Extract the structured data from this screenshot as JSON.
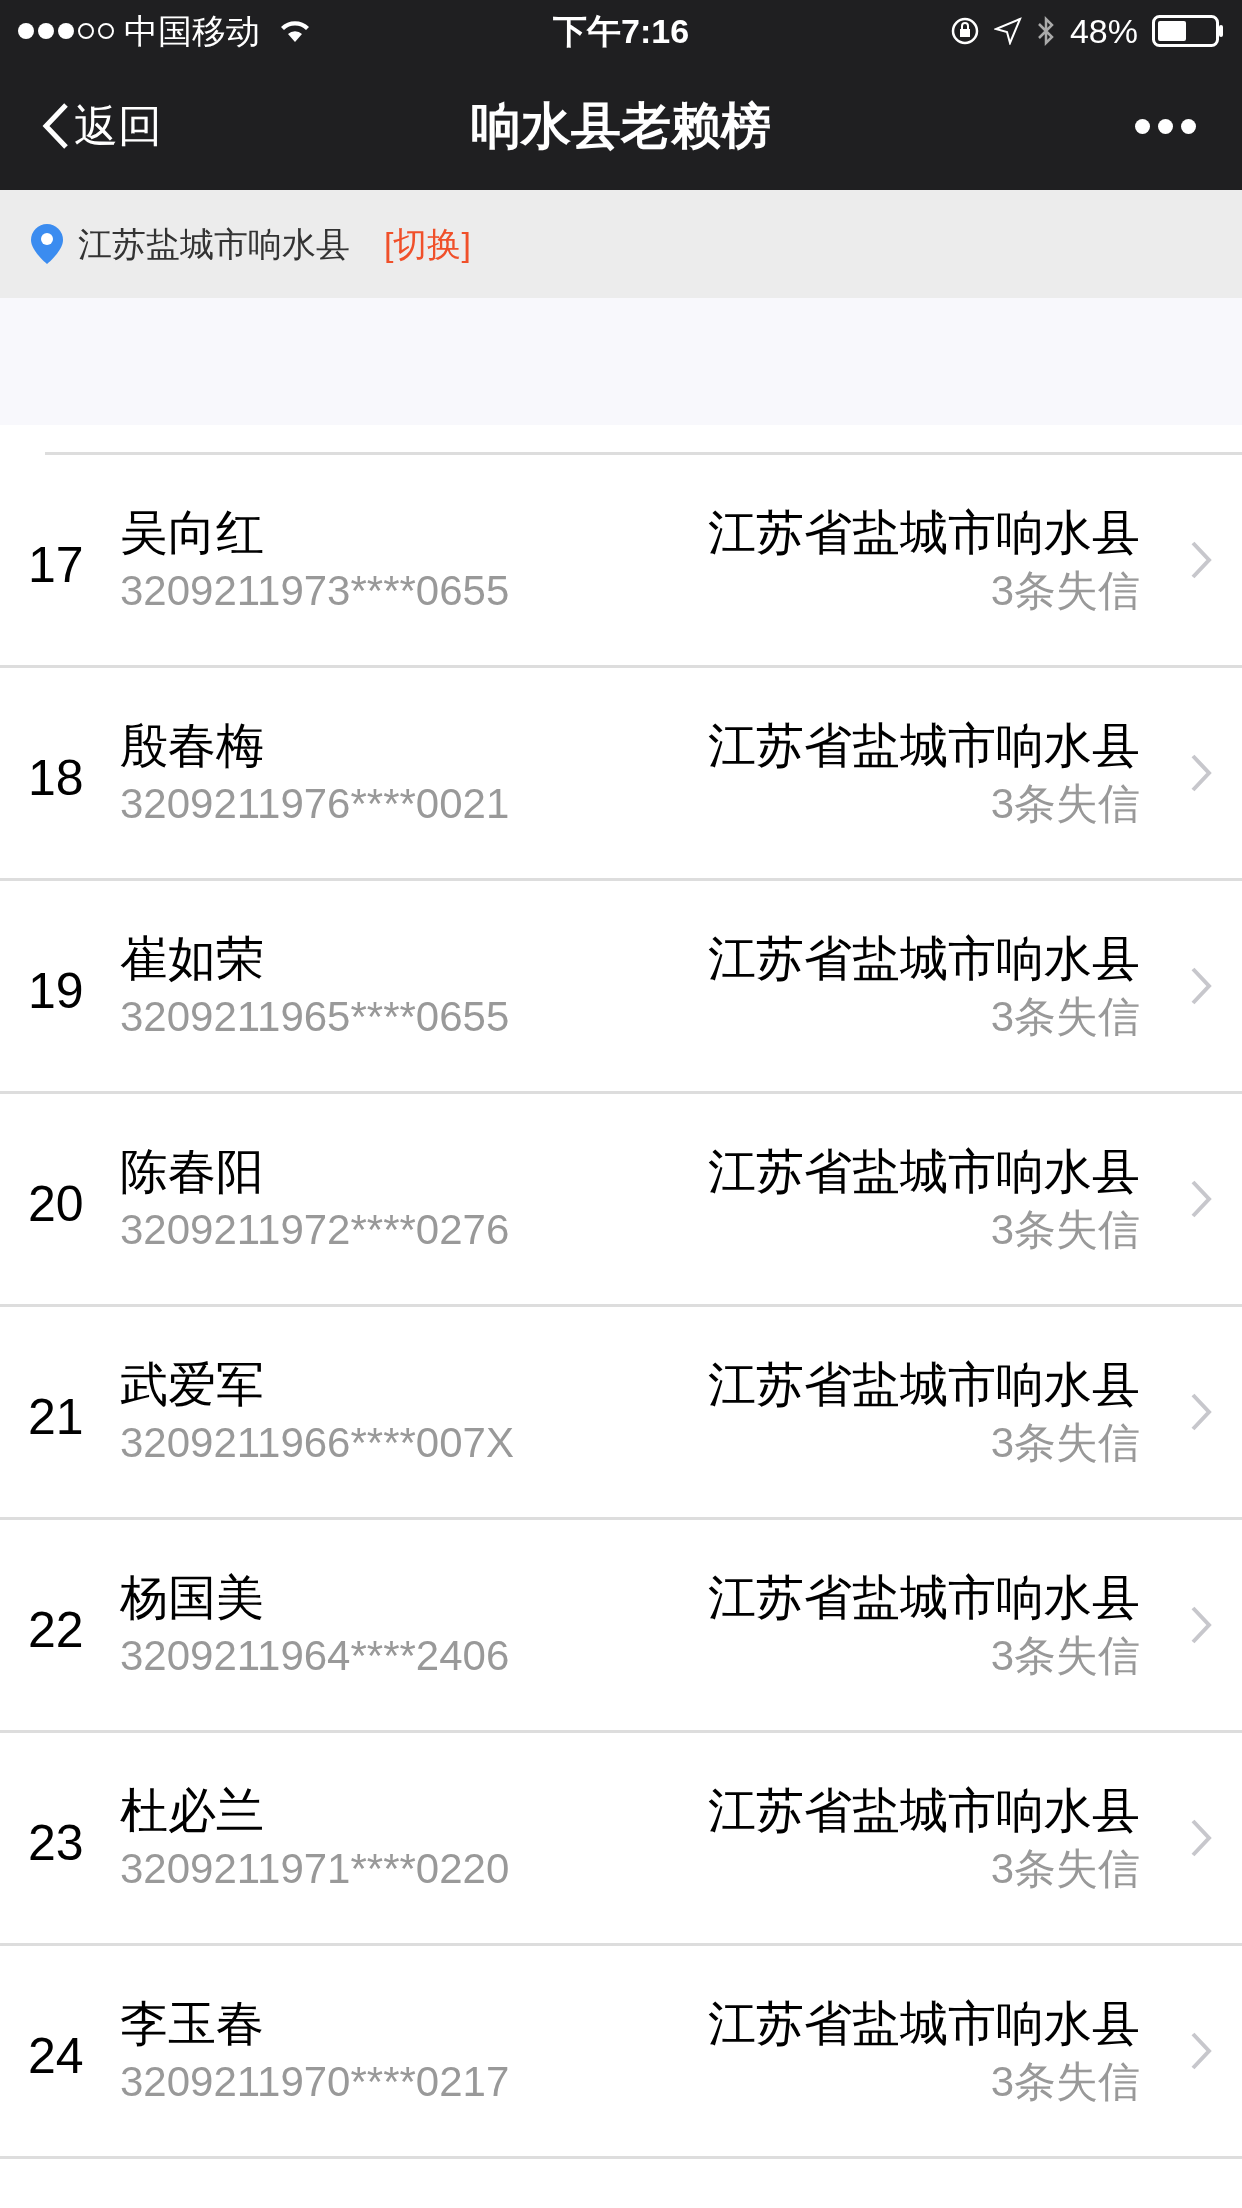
{
  "status_bar": {
    "carrier": "中国移动",
    "time": "下午7:16",
    "battery": "48%"
  },
  "nav_bar": {
    "back": "返回",
    "title": "响水县老赖榜"
  },
  "location": {
    "text": "江苏盐城市响水县",
    "switch": "[切换]"
  },
  "rows": [
    {
      "rank": "17",
      "name": "吴向红",
      "id": "3209211973****0655",
      "address": "江苏省盐城市响水县",
      "records": "3条失信"
    },
    {
      "rank": "18",
      "name": "殷春梅",
      "id": "3209211976****0021",
      "address": "江苏省盐城市响水县",
      "records": "3条失信"
    },
    {
      "rank": "19",
      "name": "崔如荣",
      "id": "3209211965****0655",
      "address": "江苏省盐城市响水县",
      "records": "3条失信"
    },
    {
      "rank": "20",
      "name": "陈春阳",
      "id": "3209211972****0276",
      "address": "江苏省盐城市响水县",
      "records": "3条失信"
    },
    {
      "rank": "21",
      "name": "武爱军",
      "id": "3209211966****007X",
      "address": "江苏省盐城市响水县",
      "records": "3条失信"
    },
    {
      "rank": "22",
      "name": "杨国美",
      "id": "3209211964****2406",
      "address": "江苏省盐城市响水县",
      "records": "3条失信"
    },
    {
      "rank": "23",
      "name": "杜必兰",
      "id": "3209211971****0220",
      "address": "江苏省盐城市响水县",
      "records": "3条失信"
    },
    {
      "rank": "24",
      "name": "李玉春",
      "id": "3209211970****0217",
      "address": "江苏省盐城市响水县",
      "records": "3条失信"
    }
  ]
}
